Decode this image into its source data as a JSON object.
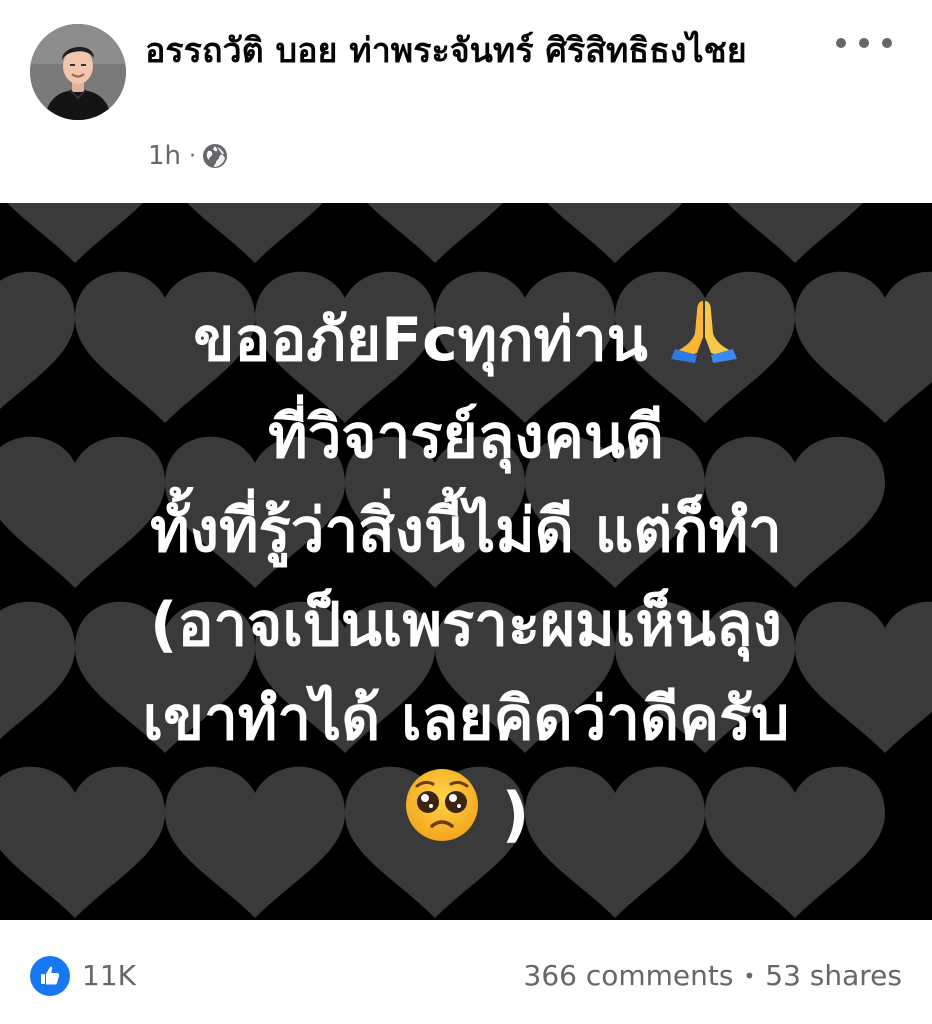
{
  "post": {
    "author_name": "อรรถวัติ บอย ท่าพระจันทร์ ศิริสิทธิธงไชย",
    "time": "1h",
    "meta_separator": "·",
    "privacy_icon": "globe-icon",
    "more_icon": "more-options-icon"
  },
  "image": {
    "lines": [
      "ขออภัยFcทุกท่าน",
      "ที่วิจารย์ลุงคนดี",
      "ทั้งที่รู้ว่าสิ่งนี้ไม่ดี แต่ก็ทำ",
      "(อาจเป็นเพราะผมเห็นลุง",
      "เขาทำได้ เลยคิดว่าดีครับ",
      ")"
    ],
    "emoji_line1": "folded-hands-emoji",
    "emoji_last": "pleading-face-emoji",
    "background": "dark-gray-hearts-pattern",
    "colors": {
      "background": "#000000",
      "hearts": "#3a3a3a",
      "text": "#ffffff"
    }
  },
  "footer": {
    "like_icon": "thumbs-up-icon",
    "reaction_count": "11K",
    "comments": "366 comments",
    "separator": "•",
    "shares": "53 shares"
  },
  "colors": {
    "like_blue": "#1877f2",
    "meta_gray": "#65676b",
    "name_black": "#050505"
  }
}
